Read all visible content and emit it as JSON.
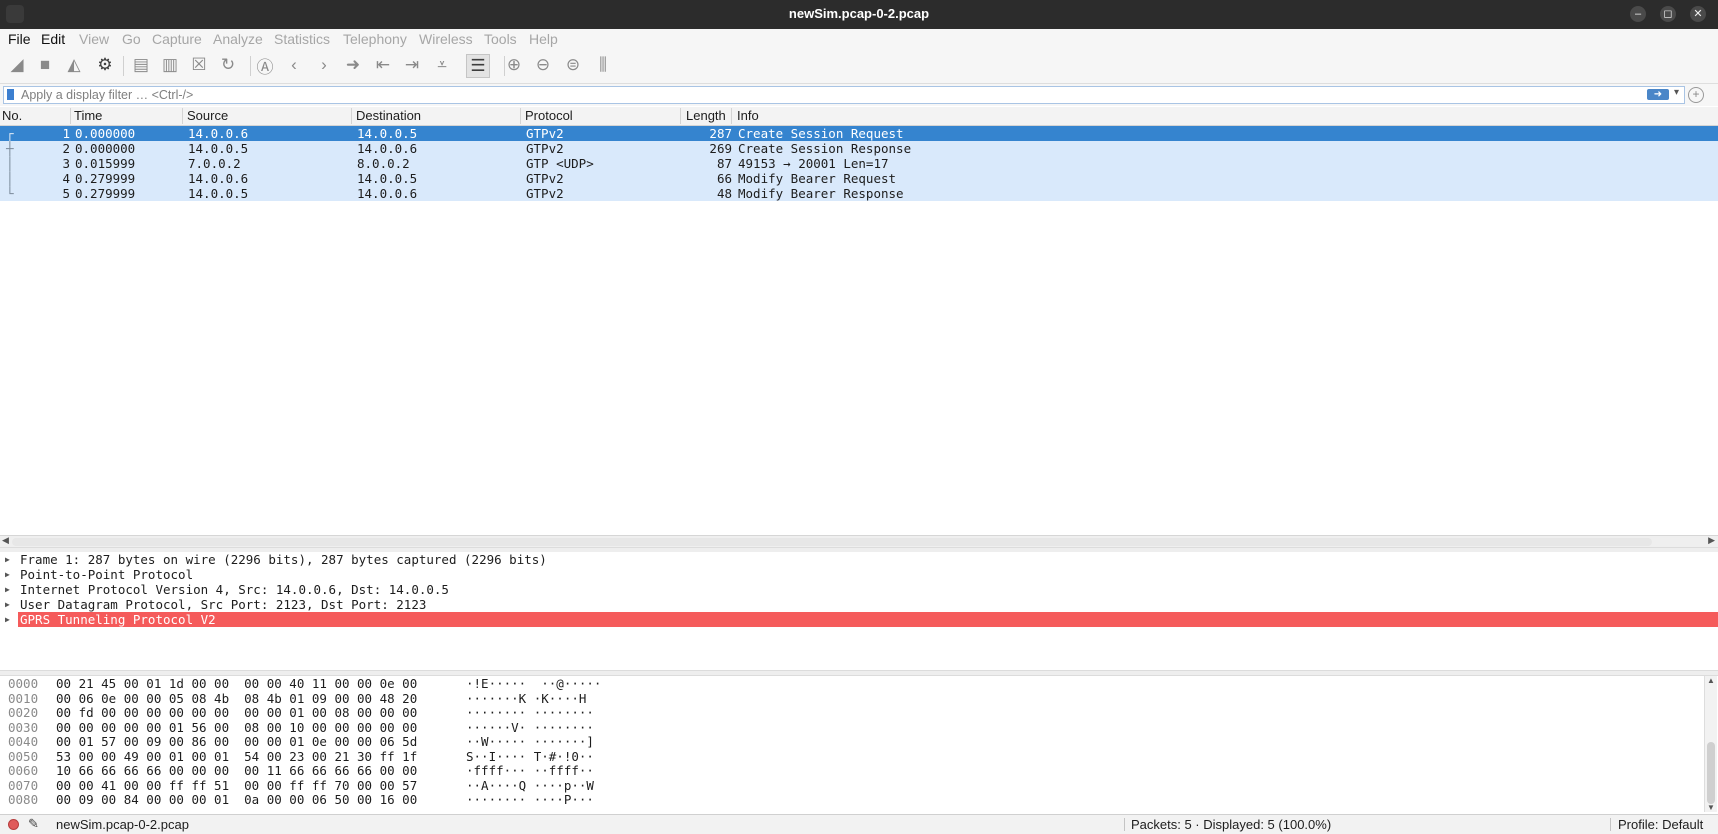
{
  "window": {
    "title": "newSim.pcap-0-2.pcap",
    "min": "–",
    "max": "◻",
    "close": "✕"
  },
  "menu": [
    {
      "label": "File",
      "enabled": true
    },
    {
      "label": "Edit",
      "enabled": true
    },
    {
      "label": "View",
      "enabled": false
    },
    {
      "label": "Go",
      "enabled": false
    },
    {
      "label": "Capture",
      "enabled": false
    },
    {
      "label": "Analyze",
      "enabled": false
    },
    {
      "label": "Statistics",
      "enabled": false
    },
    {
      "label": "Telephony",
      "enabled": false
    },
    {
      "label": "Wireless",
      "enabled": false
    },
    {
      "label": "Tools",
      "enabled": false
    },
    {
      "label": "Help",
      "enabled": false
    }
  ],
  "toolbar": {
    "icons": [
      "shark-fin-start-icon",
      "stop-square-icon",
      "shark-fin-restart-icon",
      "capture-options-gear-icon",
      "open-folder-icon",
      "save-file-icon",
      "close-file-icon",
      "reload-file-icon",
      "find-packet-icon",
      "go-back-icon",
      "go-forward-icon",
      "go-to-packet-icon",
      "first-packet-icon",
      "last-packet-icon",
      "autoscroll-icon",
      "colorize-icon",
      "zoom-in-icon",
      "zoom-out-icon",
      "normal-size-icon",
      "resize-columns-icon"
    ]
  },
  "filter": {
    "placeholder": "Apply a display filter … <Ctrl-/>",
    "apply_label": "➜",
    "dropdown_label": "▾",
    "add_label": "+"
  },
  "packet_list": {
    "columns": [
      "No.",
      "Time",
      "Source",
      "Destination",
      "Protocol",
      "Length",
      "Info"
    ],
    "rows": [
      {
        "no": "1",
        "time": "0.000000",
        "source": "14.0.0.6",
        "destination": "14.0.0.5",
        "protocol": "GTPv2",
        "length": "287",
        "info": "Create Session Request",
        "selected": true
      },
      {
        "no": "2",
        "time": "0.000000",
        "source": "14.0.0.5",
        "destination": "14.0.0.6",
        "protocol": "GTPv2",
        "length": "269",
        "info": "Create Session Response",
        "selected": false
      },
      {
        "no": "3",
        "time": "0.015999",
        "source": "7.0.0.2",
        "destination": "8.0.0.2",
        "protocol": "GTP <UDP>",
        "length": "87",
        "info": "49153 → 20001 Len=17",
        "selected": false
      },
      {
        "no": "4",
        "time": "0.279999",
        "source": "14.0.0.6",
        "destination": "14.0.0.5",
        "protocol": "GTPv2",
        "length": "66",
        "info": "Modify Bearer Request",
        "selected": false
      },
      {
        "no": "5",
        "time": "0.279999",
        "source": "14.0.0.5",
        "destination": "14.0.0.6",
        "protocol": "GTPv2",
        "length": "48",
        "info": "Modify Bearer Response",
        "selected": false
      }
    ]
  },
  "details": [
    {
      "text": "Frame 1: 287 bytes on wire (2296 bits), 287 bytes captured (2296 bits)",
      "highlighted": false
    },
    {
      "text": "Point-to-Point Protocol",
      "highlighted": false
    },
    {
      "text": "Internet Protocol Version 4, Src: 14.0.0.6, Dst: 14.0.0.5",
      "highlighted": false
    },
    {
      "text": "User Datagram Protocol, Src Port: 2123, Dst Port: 2123",
      "highlighted": false
    },
    {
      "text": "GPRS Tunneling Protocol V2",
      "highlighted": true
    }
  ],
  "bytes": [
    {
      "offset": "0000",
      "hex": "00 21 45 00 01 1d 00 00  00 00 40 11 00 00 0e 00",
      "ascii": "·!E·····  ··@·····"
    },
    {
      "offset": "0010",
      "hex": "00 06 0e 00 00 05 08 4b  08 4b 01 09 00 00 48 20",
      "ascii": "·······K ·K····H "
    },
    {
      "offset": "0020",
      "hex": "00 fd 00 00 00 00 00 00  00 00 01 00 08 00 00 00",
      "ascii": "········ ········"
    },
    {
      "offset": "0030",
      "hex": "00 00 00 00 00 01 56 00  08 00 10 00 00 00 00 00",
      "ascii": "······V· ········"
    },
    {
      "offset": "0040",
      "hex": "00 01 57 00 09 00 86 00  00 00 01 0e 00 00 06 5d",
      "ascii": "··W····· ·······]"
    },
    {
      "offset": "0050",
      "hex": "53 00 00 49 00 01 00 01  54 00 23 00 21 30 ff 1f",
      "ascii": "S··I···· T·#·!0··"
    },
    {
      "offset": "0060",
      "hex": "10 66 66 66 66 00 00 00  00 11 66 66 66 66 00 00",
      "ascii": "·ffff··· ··ffff··"
    },
    {
      "offset": "0070",
      "hex": "00 00 41 00 00 ff ff 51  00 00 ff ff 70 00 00 57",
      "ascii": "··A····Q ····p··W"
    },
    {
      "offset": "0080",
      "hex": "00 09 00 84 00 00 00 01  0a 00 00 06 50 00 16 00",
      "ascii": "········ ····P···"
    }
  ],
  "status": {
    "file": "newSim.pcap-0-2.pcap",
    "packets": "Packets: 5 · Displayed: 5 (100.0%)",
    "profile": "Profile: Default"
  }
}
